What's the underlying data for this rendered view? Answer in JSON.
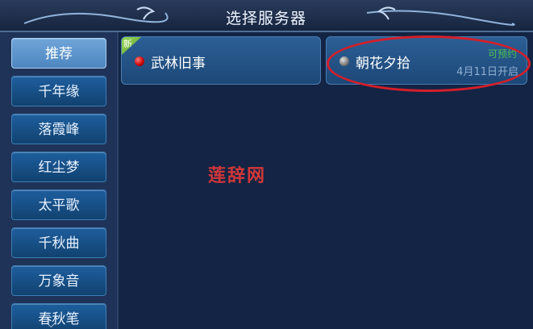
{
  "window": {
    "title": "选择服务器"
  },
  "sidebar": {
    "items": [
      {
        "label": "推荐",
        "active": true
      },
      {
        "label": "千年缘"
      },
      {
        "label": "落霞峰"
      },
      {
        "label": "红尘梦"
      },
      {
        "label": "太平歌"
      },
      {
        "label": "千秋曲"
      },
      {
        "label": "万象音"
      },
      {
        "label": "春秋笔"
      }
    ],
    "scroll_icon": "chevron-down-icon"
  },
  "servers": [
    {
      "name": "武林旧事",
      "badge": "新",
      "status_color": "#c40000"
    },
    {
      "name": "朝花夕拾",
      "status_label": "可预约",
      "open_date": "4月11日开启",
      "status_color": "#7a7a7a"
    }
  ],
  "colors": {
    "accent": "#3d7fb8",
    "highlight": "#d31f2b",
    "status_green": "#4fc04f"
  },
  "watermark": "莲辞网"
}
